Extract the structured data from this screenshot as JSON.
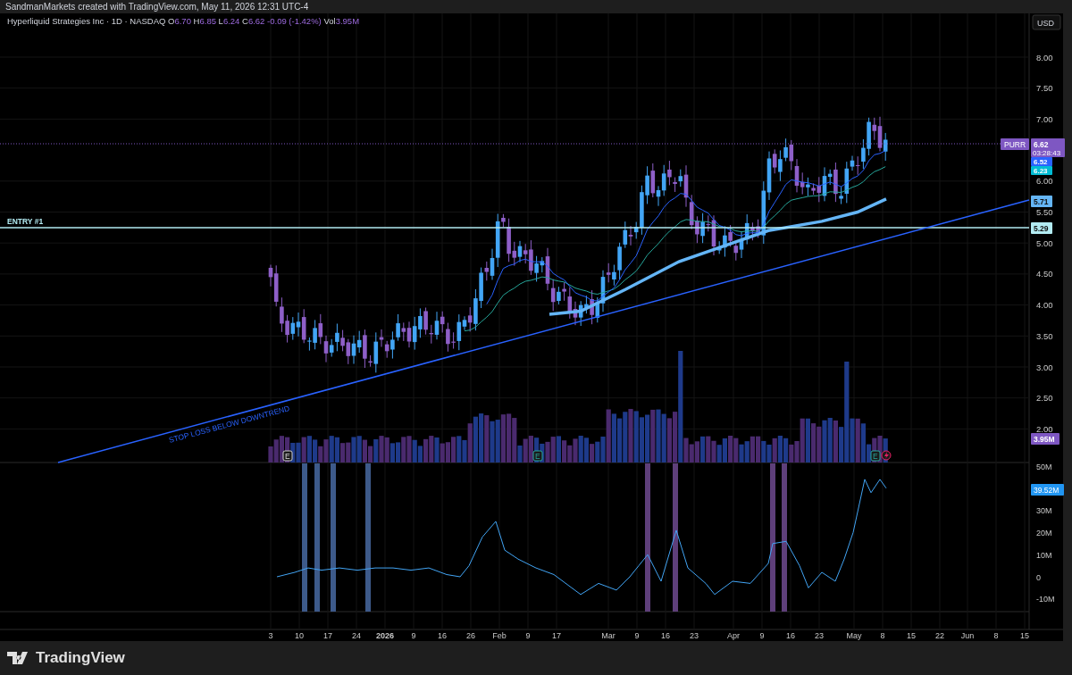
{
  "attribution": "SandmanMarkets created with TradingView.com, May 11, 2026 12:31 UTC-4",
  "legend": {
    "title": "Hyperliquid Strategies Inc · 1D · NASDAQ",
    "values": [
      {
        "key": "O",
        "value": "6.70"
      },
      {
        "key": "H",
        "value": "6.85"
      },
      {
        "key": "L",
        "value": "6.24"
      },
      {
        "key": "C",
        "value": "6.62"
      }
    ],
    "change": "-0.09 (-1.42%)",
    "volume_key": "Vol",
    "volume": "3.95M"
  },
  "currency": "USD",
  "price_axis": {
    "ticks": [
      "8.00",
      "7.50",
      "7.00",
      "6.00",
      "5.50",
      "5.00",
      "4.50",
      "4.00",
      "3.50",
      "3.00",
      "2.50",
      "2.00"
    ]
  },
  "price_labels": [
    {
      "text": "6.62",
      "sub": "03:28:43",
      "tag": "PURR",
      "color": "#7e57c2"
    },
    {
      "text": "6.52",
      "color": "#2962ff"
    },
    {
      "text": "6.23",
      "color": "#00bcd4"
    },
    {
      "text": "5.71",
      "color": "#64b5f6"
    },
    {
      "text": "5.29",
      "color": "#b2ebf2"
    },
    {
      "text": "3.95M",
      "color": "#7e57c2"
    }
  ],
  "drawings": [
    {
      "kind": "horizontal",
      "label": "ENTRY #1"
    },
    {
      "kind": "trend",
      "label": "STOP LOSS BELOW DOWNTREND"
    }
  ],
  "events": [
    {
      "label": "E"
    },
    {
      "label": "E"
    },
    {
      "label": "E"
    }
  ],
  "indicator_axis": {
    "ticks": [
      "50M",
      "30M",
      "20M",
      "10M",
      "0",
      "-10M"
    ],
    "label": "39.52M"
  },
  "time_axis": [
    {
      "text": "3",
      "bold": false
    },
    {
      "text": "10",
      "bold": false
    },
    {
      "text": "17",
      "bold": false
    },
    {
      "text": "24",
      "bold": false
    },
    {
      "text": "2026",
      "bold": true
    },
    {
      "text": "9",
      "bold": false
    },
    {
      "text": "16",
      "bold": false
    },
    {
      "text": "26",
      "bold": false
    },
    {
      "text": "Feb",
      "bold": false
    },
    {
      "text": "9",
      "bold": false
    },
    {
      "text": "17",
      "bold": false
    },
    {
      "text": "Mar",
      "bold": false
    },
    {
      "text": "9",
      "bold": false
    },
    {
      "text": "16",
      "bold": false
    },
    {
      "text": "23",
      "bold": false
    },
    {
      "text": "Apr",
      "bold": false
    },
    {
      "text": "9",
      "bold": false
    },
    {
      "text": "16",
      "bold": false
    },
    {
      "text": "23",
      "bold": false
    },
    {
      "text": "May",
      "bold": false
    },
    {
      "text": "8",
      "bold": false
    },
    {
      "text": "15",
      "bold": false
    },
    {
      "text": "22",
      "bold": false
    },
    {
      "text": "Jun",
      "bold": false
    },
    {
      "text": "8",
      "bold": false
    },
    {
      "text": "15",
      "bold": false
    }
  ],
  "footer": {
    "brand": "TradingView"
  }
}
